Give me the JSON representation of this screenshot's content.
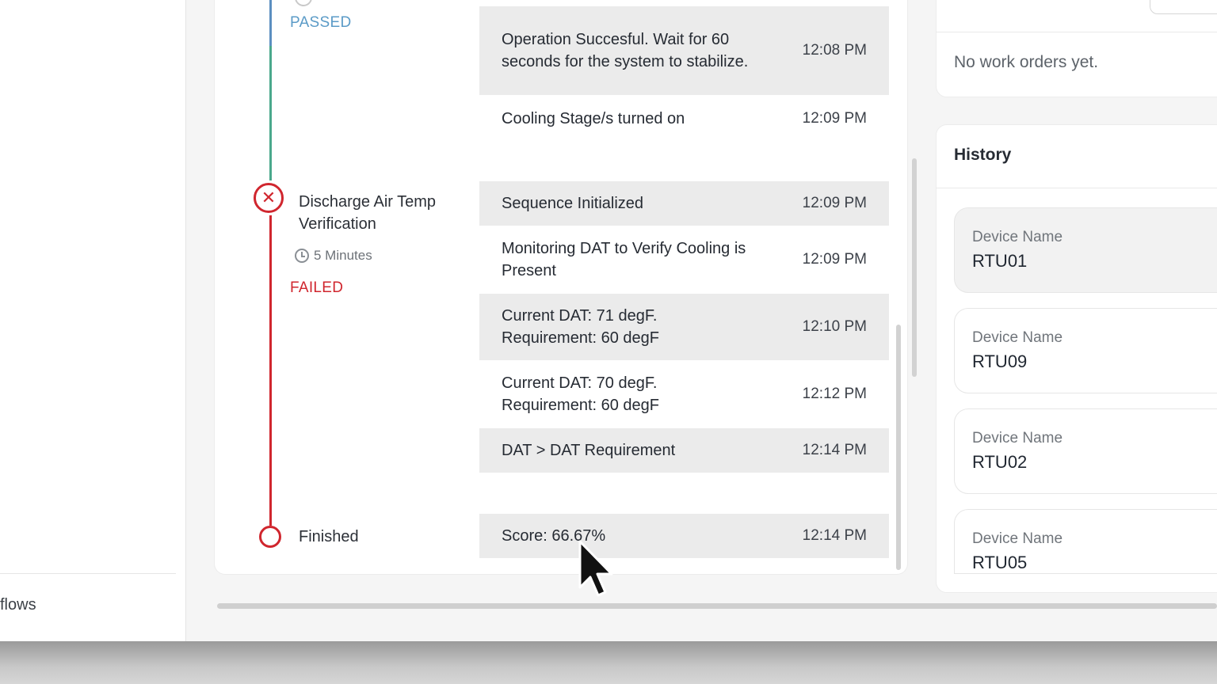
{
  "sidebar": {
    "bottom_item": "flows"
  },
  "timeline": {
    "passed_status": "PASSED",
    "step2": {
      "title": "Discharge Air Temp Verification",
      "duration": "5 Minutes",
      "status": "FAILED"
    },
    "finished_label": "Finished",
    "colors": {
      "passed": "#5b9bc7",
      "failed": "#d0262e",
      "line_pass": "#4aa88c"
    }
  },
  "log": [
    {
      "text": "Operation Succesful. Wait for 60 seconds for the system to stabilize.",
      "time": "12:08 PM"
    },
    {
      "text": "Cooling Stage/s turned on",
      "time": "12:09 PM"
    },
    {
      "text": "Sequence Initialized",
      "time": "12:09 PM"
    },
    {
      "text": "Monitoring DAT to Verify Cooling is Present",
      "time": "12:09 PM"
    },
    {
      "text": "Current DAT: 71 degF. Requirement: 60 degF",
      "time": "12:10 PM"
    },
    {
      "text": "Current DAT: 70 degF. Requirement: 60 degF",
      "time": "12:12 PM"
    },
    {
      "text": "DAT > DAT Requirement",
      "time": "12:14 PM"
    },
    {
      "text": "Score: 66.67%",
      "time": "12:14 PM"
    }
  ],
  "work_orders": {
    "empty_text": "No work orders yet."
  },
  "history": {
    "title": "History",
    "items": [
      {
        "label": "Device Name",
        "value": "RTU01"
      },
      {
        "label": "Device Name",
        "value": "RTU09"
      },
      {
        "label": "Device Name",
        "value": "RTU02"
      },
      {
        "label": "Device Name",
        "value": "RTU05"
      }
    ]
  },
  "icons": {
    "fail": "x-circle-icon",
    "clock": "clock-icon",
    "cursor": "mouse-pointer-icon"
  }
}
